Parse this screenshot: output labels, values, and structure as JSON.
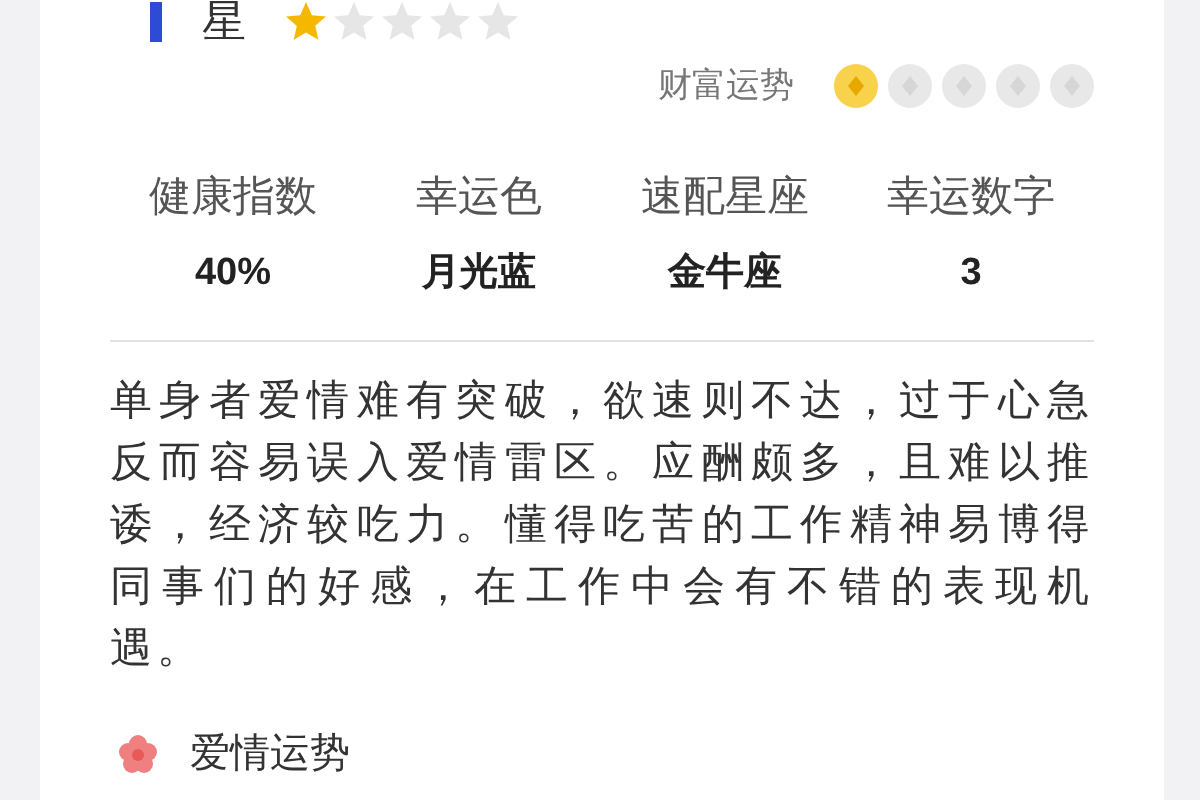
{
  "header": {
    "label": "星",
    "stars": 1
  },
  "fortune_rows": [
    {
      "label": "财富运势",
      "stars": 1
    }
  ],
  "stats": [
    {
      "label": "健康指数",
      "value": "40%"
    },
    {
      "label": "幸运色",
      "value": "月光蓝"
    },
    {
      "label": "速配星座",
      "value": "金牛座"
    },
    {
      "label": "幸运数字",
      "value": "3"
    }
  ],
  "description": "单身者爱情难有突破，欲速则不达，过于心急反而容易误入爱情雷区。应酬颇多，且难以推诿，经济较吃力。懂得吃苦的工作精神易博得同事们的好感，在工作中会有不错的表现机遇。",
  "section": {
    "title": "爱情运势"
  }
}
